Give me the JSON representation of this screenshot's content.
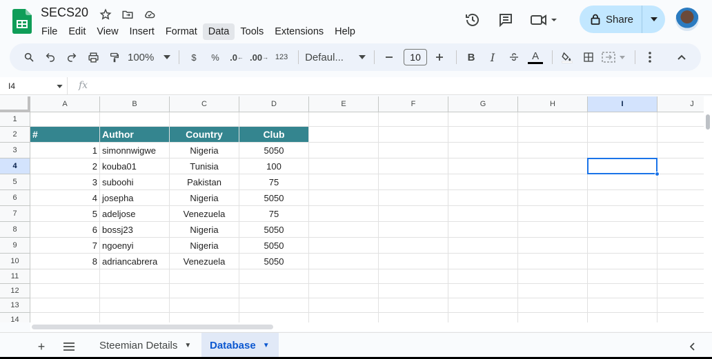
{
  "app": {
    "title": "SECS20",
    "menus": [
      "File",
      "Edit",
      "View",
      "Insert",
      "Format",
      "Data",
      "Tools",
      "Extensions",
      "Help"
    ],
    "active_menu": "Data",
    "share_label": "Share"
  },
  "toolbar": {
    "zoom": "100%",
    "currency": "$",
    "percent": "%",
    "dec_decrease": ".0",
    "dec_increase": ".00",
    "number_format": "123",
    "font": "Defaul...",
    "font_size": "10",
    "bold": "B",
    "italic": "I",
    "text_color": "A"
  },
  "formula": {
    "name_box": "I4",
    "fx": "fx",
    "value": ""
  },
  "grid": {
    "columns": [
      "A",
      "B",
      "C",
      "D",
      "E",
      "F",
      "G",
      "H",
      "I",
      "J"
    ],
    "rows": [
      "1",
      "2",
      "3",
      "4",
      "5",
      "6",
      "7",
      "8",
      "9",
      "10",
      "11",
      "12",
      "13",
      "14"
    ],
    "selected_column": "I",
    "selected_row": "4",
    "header_cells": [
      "#",
      "Author",
      "Country",
      "Club"
    ],
    "data": [
      [
        "1",
        "simonnwigwe",
        "Nigeria",
        "5050"
      ],
      [
        "2",
        "kouba01",
        "Tunisia",
        "100"
      ],
      [
        "3",
        "suboohi",
        "Pakistan",
        "75"
      ],
      [
        "4",
        "josepha",
        "Nigeria",
        "5050"
      ],
      [
        "5",
        "adeljose",
        "Venezuela",
        "75"
      ],
      [
        "6",
        "bossj23",
        "Nigeria",
        "5050"
      ],
      [
        "7",
        "ngoenyi",
        "Nigeria",
        "5050"
      ],
      [
        "8",
        "adriancabrera",
        "Venezuela",
        "5050"
      ]
    ],
    "header_color": "#34858f",
    "selection_color": "#1a73e8"
  },
  "sheets": {
    "tabs": [
      "Steemian Details",
      "Database"
    ],
    "active": "Database"
  }
}
